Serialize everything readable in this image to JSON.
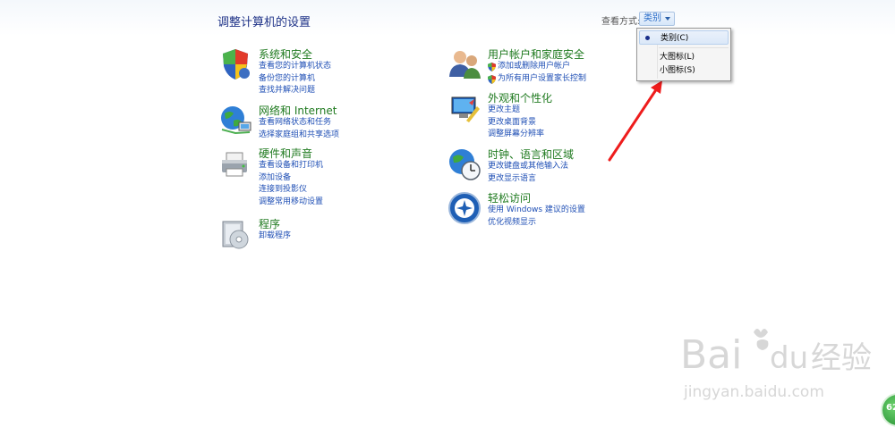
{
  "header": {
    "title": "调整计算机的设置",
    "view_by_label": "查看方式:",
    "view_by_value": "类别"
  },
  "view_menu": {
    "items": [
      {
        "label": "类别(C)",
        "selected": true
      },
      {
        "label": "大图标(L)",
        "selected": false
      },
      {
        "label": "小图标(S)",
        "selected": false
      }
    ]
  },
  "categories": {
    "system": {
      "title": "系统和安全",
      "links": [
        "查看您的计算机状态",
        "备份您的计算机",
        "查找并解决问题"
      ]
    },
    "network": {
      "title": "网络和 Internet",
      "links": [
        "查看网络状态和任务",
        "选择家庭组和共享选项"
      ]
    },
    "hardware": {
      "title": "硬件和声音",
      "links": [
        "查看设备和打印机",
        "添加设备",
        "连接到投影仪",
        "调整常用移动设置"
      ]
    },
    "programs": {
      "title": "程序",
      "links": [
        "卸载程序"
      ]
    },
    "users": {
      "title": "用户帐户和家庭安全",
      "links": [
        "添加或删除用户帐户",
        "为所有用户设置家长控制"
      ]
    },
    "appearance": {
      "title": "外观和个性化",
      "links": [
        "更改主题",
        "更改桌面背景",
        "调整屏幕分辨率"
      ]
    },
    "clock": {
      "title": "时钟、语言和区域",
      "links": [
        "更改键盘或其他输入法",
        "更改显示语言"
      ]
    },
    "ease": {
      "title": "轻松访问",
      "links": [
        "使用 Windows 建议的设置",
        "优化视频显示"
      ]
    }
  },
  "annotation": {
    "color": "#ee1c1c"
  },
  "watermark": {
    "brand": "Bai",
    "brand2": "du",
    "cn": "经验",
    "url": "jingyan.baidu.com"
  },
  "badge": {
    "text": "62"
  }
}
